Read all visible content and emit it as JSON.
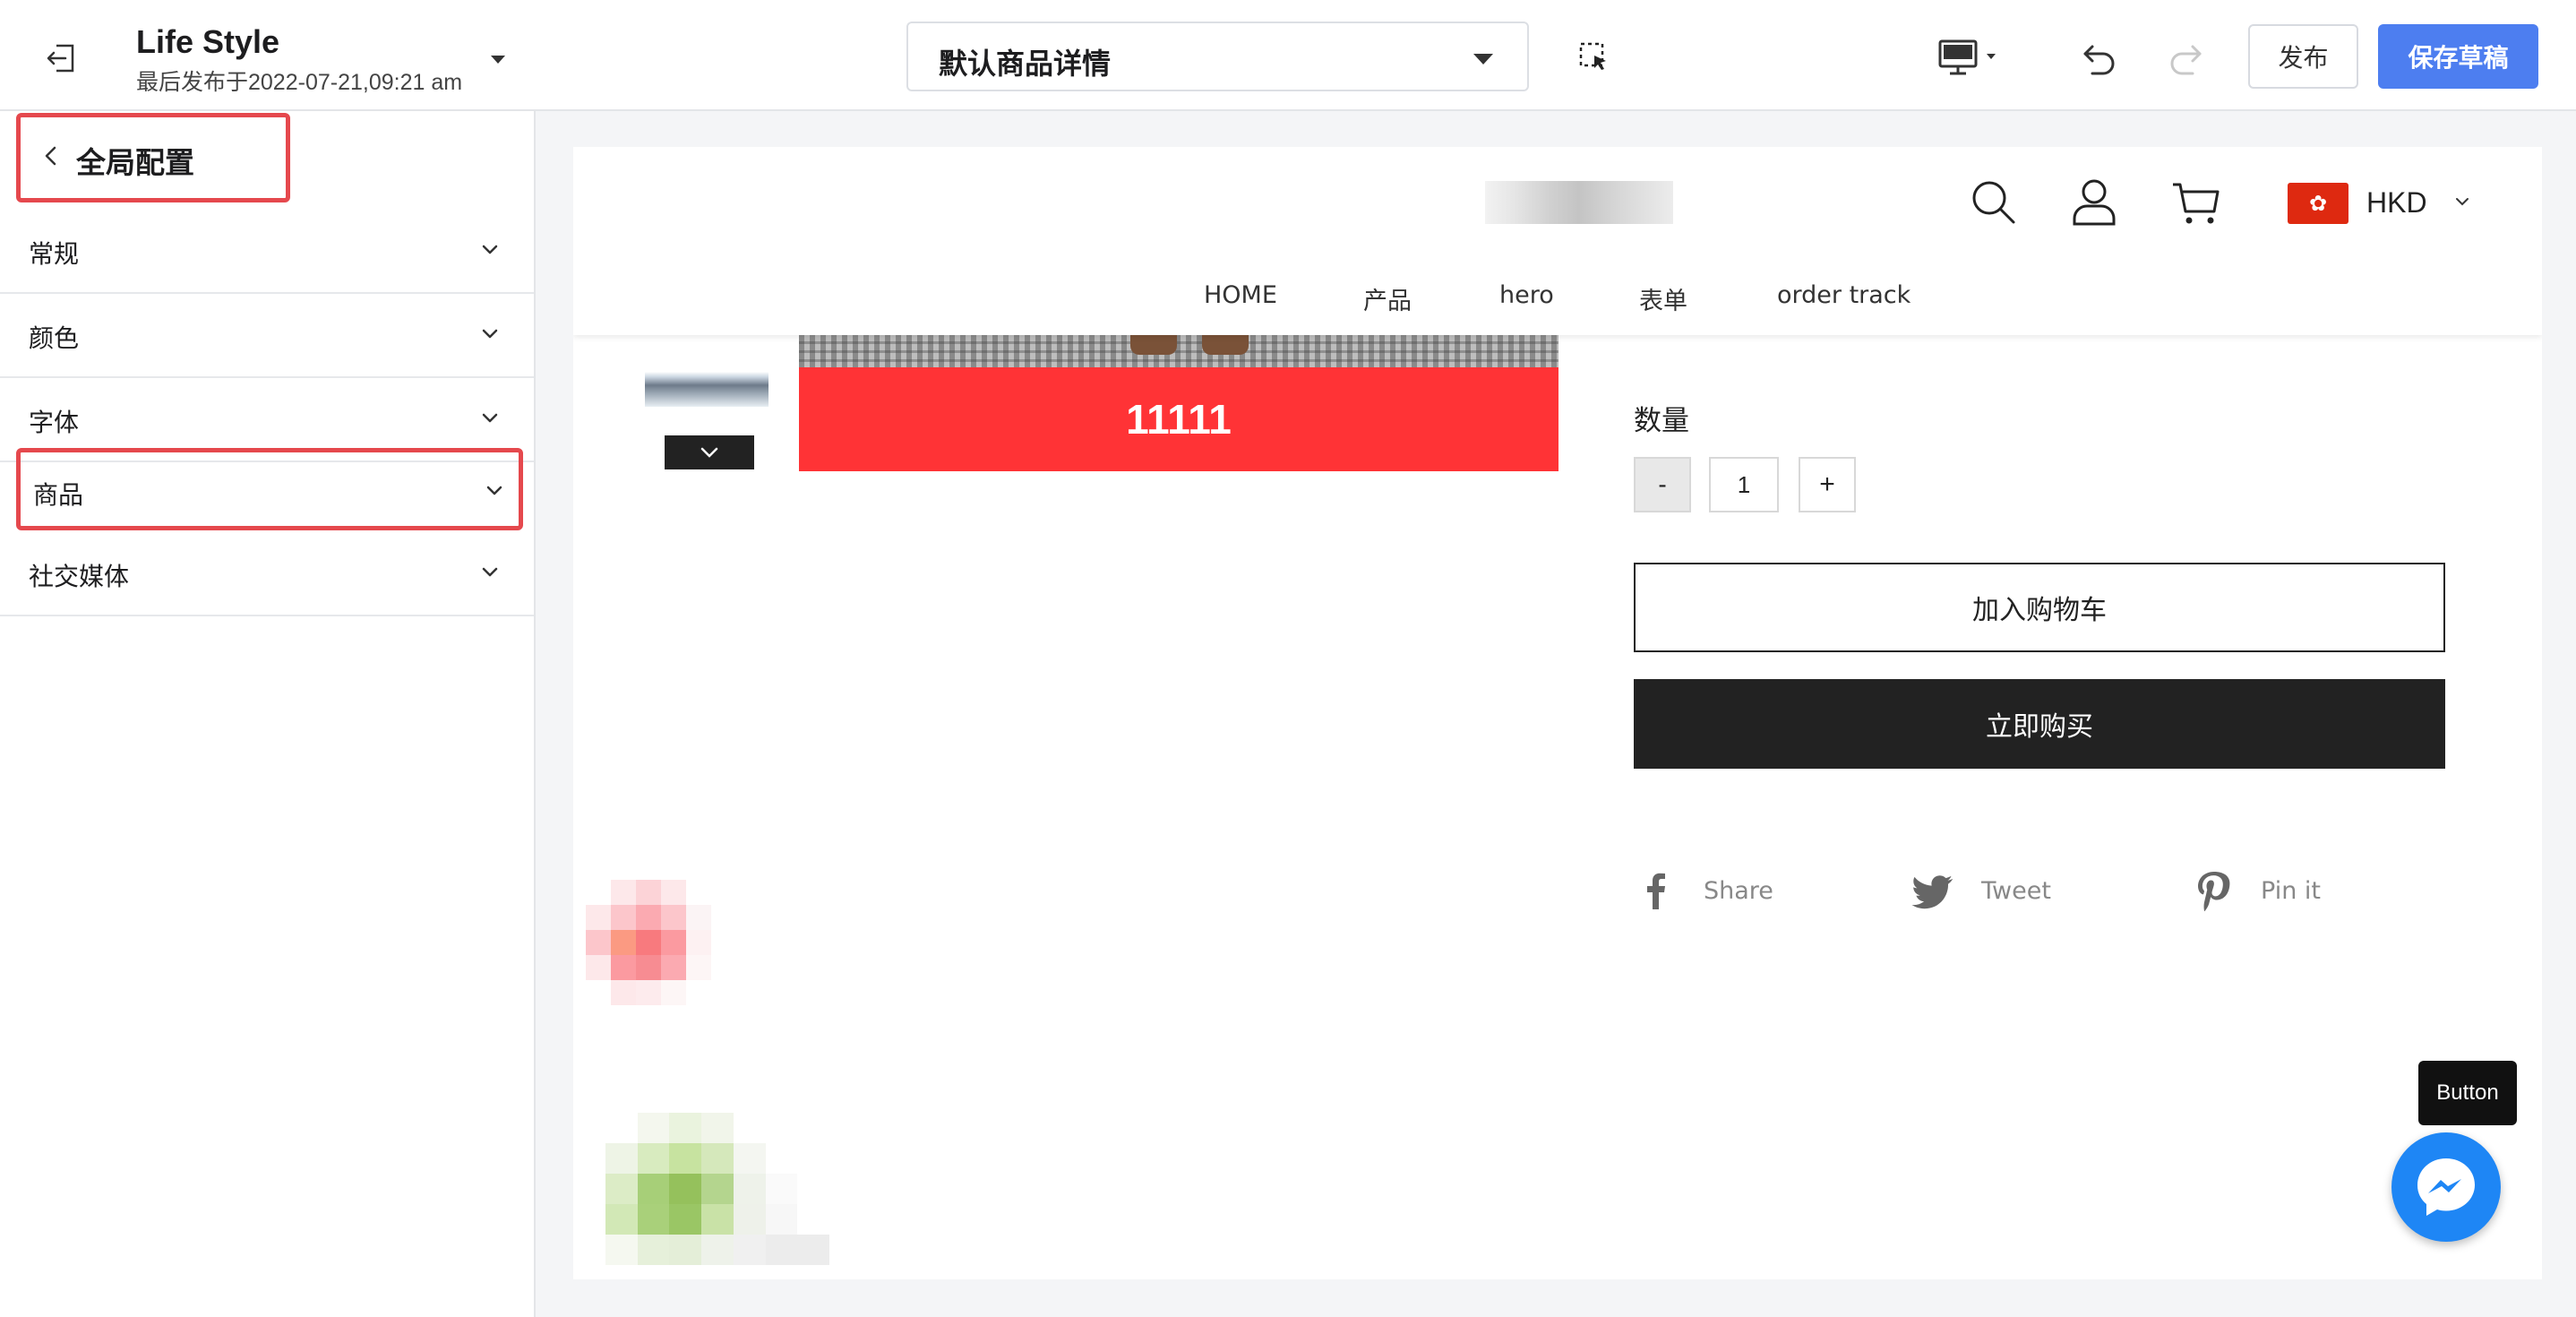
{
  "topbar": {
    "site_title": "Life Style",
    "site_subtitle": "最后发布于2022-07-21,09:21 am",
    "page_select_value": "默认商品详情",
    "publish_label": "发布",
    "save_draft_label": "保存草稿",
    "icons": [
      "exit-icon",
      "caret-down-icon",
      "inspect-select-icon",
      "desktop-device-icon",
      "undo-icon",
      "redo-icon"
    ],
    "accent_color": "#4d7ef0"
  },
  "sidebar": {
    "header": {
      "title": "全局配置"
    },
    "sections": [
      {
        "label": "常规"
      },
      {
        "label": "颜色"
      },
      {
        "label": "字体"
      },
      {
        "label": "商品"
      },
      {
        "label": "社交媒体"
      }
    ],
    "highlight_color": "#e5484d"
  },
  "store": {
    "currency": "HKD",
    "flag_glyph": "✿",
    "nav": [
      "HOME",
      "产品",
      "hero",
      "表单",
      "order track"
    ],
    "promo_text": "11111",
    "promo_color": "#ff3336",
    "quantity_label": "数量",
    "qty_minus": "-",
    "qty_value": "1",
    "qty_plus": "+",
    "add_to_cart_label": "加入购物车",
    "buy_now_label": "立即购买",
    "share": [
      {
        "label": "Share",
        "icon": "facebook-icon"
      },
      {
        "label": "Tweet",
        "icon": "twitter-icon"
      },
      {
        "label": "Pin it",
        "icon": "pinterest-icon"
      }
    ]
  },
  "floating": {
    "tooltip_text": "Button",
    "messenger_color": "#1e86f5"
  }
}
